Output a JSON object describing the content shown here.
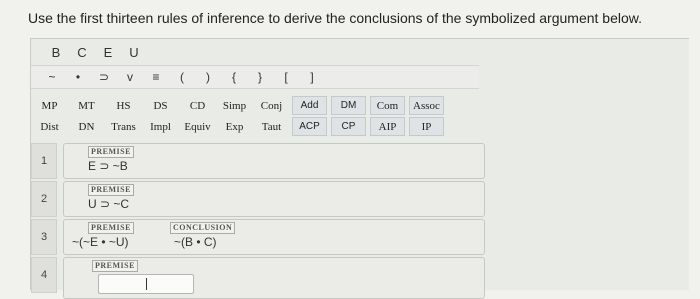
{
  "question": "Use the first thirteen rules of inference to derive the conclusions of the symbolized argument below.",
  "variables": [
    "B",
    "C",
    "E",
    "U"
  ],
  "symbols": [
    "~",
    "•",
    "⊃",
    "v",
    "≡",
    "(",
    ")",
    "{",
    "}",
    "[",
    "]"
  ],
  "rules_row1": [
    "MP",
    "MT",
    "HS",
    "DS",
    "CD",
    "Simp",
    "Conj",
    "Add",
    "DM",
    "Com",
    "Assoc"
  ],
  "rules_row2": [
    "Dist",
    "DN",
    "Trans",
    "Impl",
    "Equiv",
    "Exp",
    "Taut",
    "ACP",
    "CP",
    "AIP",
    "IP"
  ],
  "lines": [
    {
      "num": "1",
      "tag": "PREMISE",
      "formula": "E ⊃ ~B"
    },
    {
      "num": "2",
      "tag": "PREMISE",
      "formula": "U ⊃ ~C"
    },
    {
      "num": "3",
      "tag": "PREMISE",
      "formula": "~(~E • ~U)",
      "conclusion_tag": "CONCLUSION",
      "conclusion": "~(B • C)"
    },
    {
      "num": "4",
      "tag": "PREMISE",
      "formula": ""
    }
  ]
}
